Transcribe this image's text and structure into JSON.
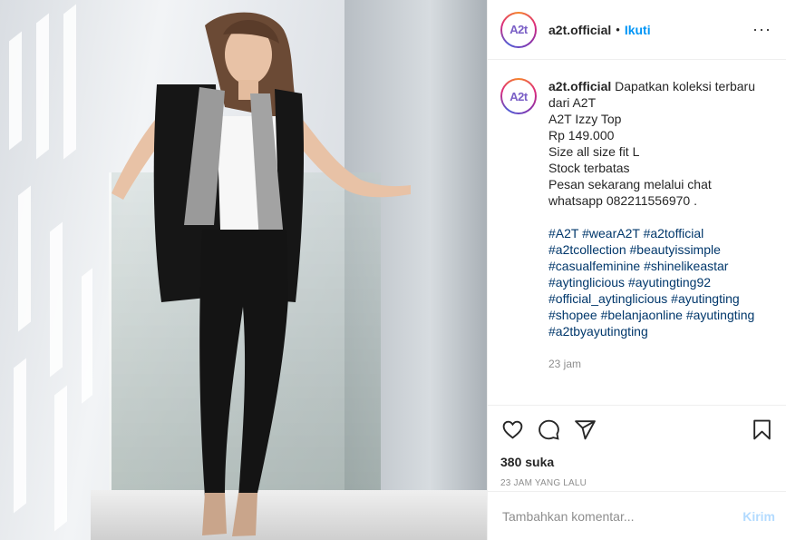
{
  "header": {
    "avatar_text": "A2t",
    "username": "a2t.official",
    "dot": "•",
    "follow_label": "Ikuti",
    "more_label": "···"
  },
  "caption": {
    "username": "a2t.official",
    "lines": [
      "Dapatkan koleksi terbaru dari A2T",
      "A2T Izzy Top",
      "Rp 149.000",
      "Size all size fit L",
      "Stock terbatas",
      "Pesan sekarang melalui chat whatsapp 082211556970 ."
    ],
    "hashtag_lines": [
      [
        "#A2T",
        "#wearA2T",
        "#a2tofficial"
      ],
      [
        "#a2tcollection",
        "#beautyissimple"
      ],
      [
        "#casualfeminine",
        "#shinelikeastar"
      ],
      [
        "#aytinglicious",
        "#ayutingting92"
      ],
      [
        "#official_aytinglicious",
        "#ayutingting"
      ],
      [
        "#shopee",
        "#belanjaonline",
        "#ayutingting"
      ],
      [
        "#a2tbyayutingting"
      ]
    ],
    "time": "23 jam"
  },
  "actions": {
    "likes": "380 suka",
    "posted": "23 JAM YANG LALU"
  },
  "comment": {
    "placeholder": "Tambahkan komentar...",
    "post_label": "Kirim"
  },
  "colors": {
    "link": "#00376b",
    "follow": "#0095f6",
    "muted": "#8e8e8e",
    "post_disabled": "#b3dbff"
  }
}
